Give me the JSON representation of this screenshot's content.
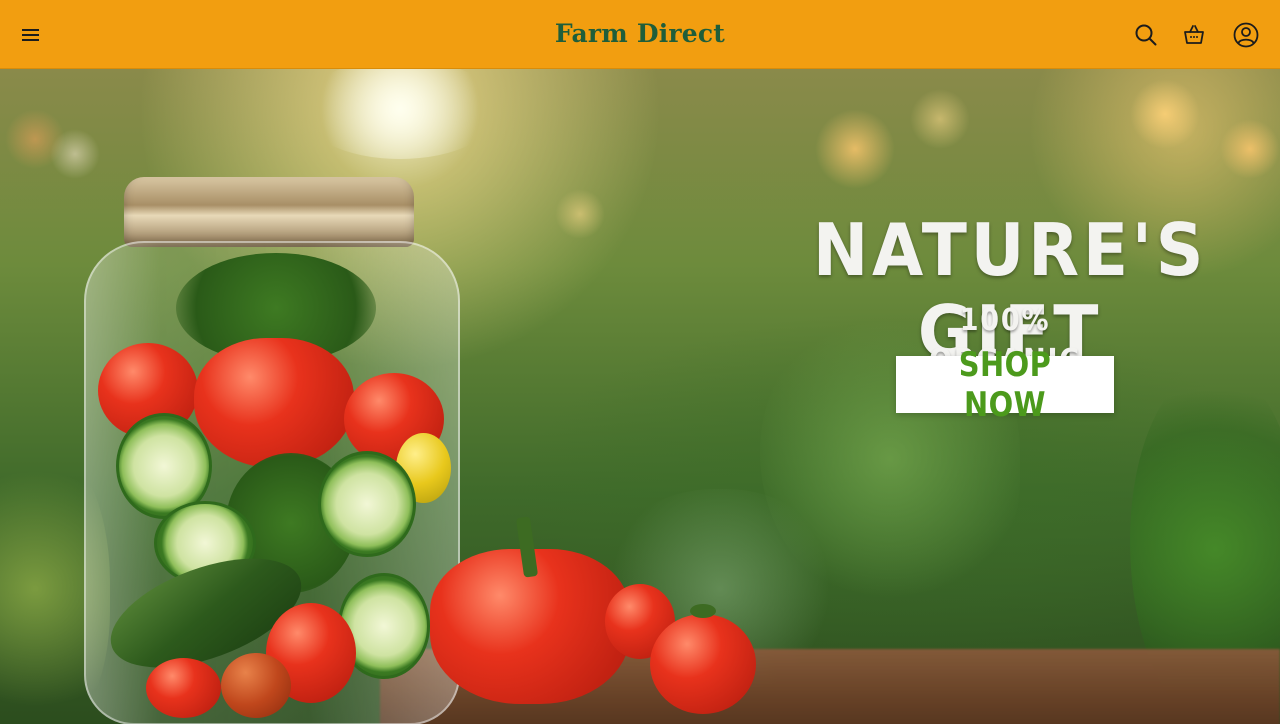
{
  "header": {
    "brand": "Farm Direct",
    "background_color": "#f29e10",
    "brand_color": "#1f5e3a",
    "icons": [
      "menu-icon",
      "search-icon",
      "basket-icon",
      "account-icon"
    ]
  },
  "hero": {
    "headline": "NATURE'S GIFT",
    "subheadline": "100% ORGANIC",
    "cta_label": "SHOP NOW",
    "cta_text_color": "#4c9a1c",
    "image_description_icon": "vegetable-jar-photo"
  }
}
